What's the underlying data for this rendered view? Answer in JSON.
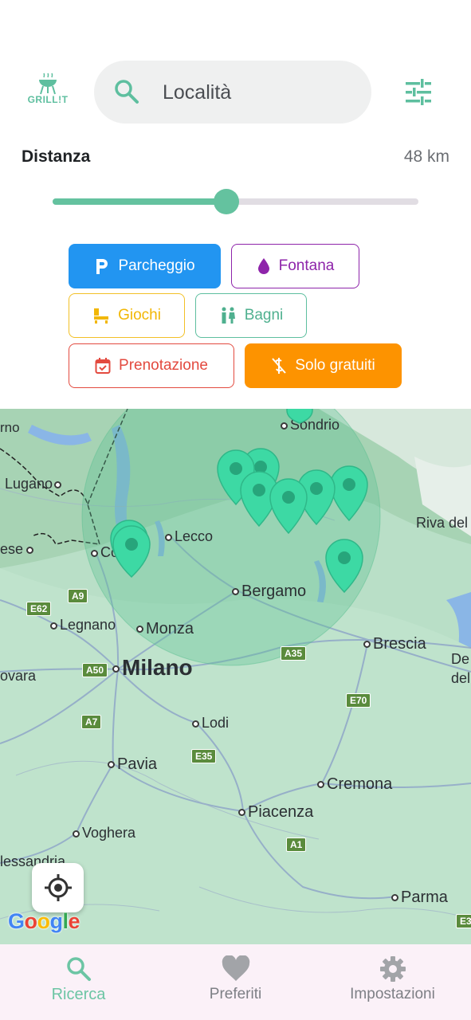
{
  "header": {
    "logo_text": "GRILL!T",
    "search_placeholder": "Località"
  },
  "distance": {
    "label": "Distanza",
    "value_text": "48 km",
    "slider_fraction": 0.475
  },
  "filters": {
    "parcheggio": "Parcheggio",
    "fontana": "Fontana",
    "giochi": "Giochi",
    "bagni": "Bagni",
    "prenotazione": "Prenotazione",
    "solo_gratuiti": "Solo gratuiti"
  },
  "map": {
    "cities": {
      "sondrio": "Sondrio",
      "lugano": "Lugano",
      "lecco": "Lecco",
      "como": "Co",
      "varese": "ese",
      "bergamo": "Bergamo",
      "riva": "Riva del",
      "legnano": "Legnano",
      "monza": "Monza",
      "brescia": "Brescia",
      "milano": "Milano",
      "novara": "ovara",
      "desenzano": "De",
      "desenzano2": "del",
      "lodi": "Lodi",
      "pavia": "Pavia",
      "cremona": "Cremona",
      "piacenza": "Piacenza",
      "voghera": "Voghera",
      "alessandria": "lessandria",
      "parma": "Parma",
      "rno": "rno"
    },
    "roads": {
      "a9": "A9",
      "e62": "E62",
      "a50": "A50",
      "a35": "A35",
      "e70": "E70",
      "a7": "A7",
      "e35": "E35",
      "a1": "A1",
      "e3": "E3"
    },
    "google_letters": [
      "G",
      "o",
      "o",
      "g",
      "l",
      "e"
    ],
    "colors": {
      "pin": "#3dd9a4",
      "radius_fill": "#5bbf92"
    }
  },
  "bottom_nav": {
    "ricerca": "Ricerca",
    "preferiti": "Preferiti",
    "impostazioni": "Impostazioni"
  }
}
